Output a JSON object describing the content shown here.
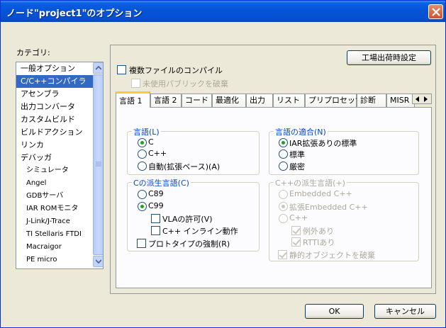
{
  "window": {
    "title": "ノード\"project1\"のオプション",
    "close_label": "close"
  },
  "category": {
    "label": "カテゴリ:",
    "items": [
      "一般オプション",
      "C/C++コンパイラ",
      "アセンブラ",
      "出力コンバータ",
      "カスタムビルド",
      "ビルドアクション",
      "リンカ",
      "デバッガ",
      "シミュレータ",
      "Angel",
      "GDBサーバ",
      "IAR ROMモニタ",
      "J-Link/J-Trace",
      "TI Stellaris FTDI",
      "Macraigor",
      "PE micro"
    ],
    "selected_index": 1
  },
  "panel": {
    "factory_button": "工場出荷時設定",
    "multi_file_compile": "複数ファイルのコンパイル",
    "discard_unused_public": "未使用パブリックを破棄",
    "tabs": [
      "言語 1",
      "言語 2",
      "コード",
      "最適化",
      "出力",
      "リスト",
      "プリプロセッサ",
      "診断",
      "MISR"
    ],
    "active_tab": 0
  },
  "tab1": {
    "language": {
      "title": "言語(L)",
      "options": [
        "C",
        "C++",
        "自動(拡張ベース)(A)"
      ],
      "selected": 0
    },
    "conformance": {
      "title": "言語の適合(N)",
      "options": [
        "IAR拡張ありの標準",
        "標準",
        "厳密"
      ],
      "selected": 0
    },
    "c_dialect": {
      "title": "Cの派生言語(C)",
      "options": [
        "C89",
        "C99"
      ],
      "selected": 1,
      "vla": "VLAの許可(V)",
      "cpp_inline": "C++ インライン動作",
      "require_prototypes": "プロトタイプの強制(R)"
    },
    "cpp_dialect": {
      "title": "C++の派生言語(+)",
      "options": [
        "Embedded C++",
        "拡張Embedded C++",
        "C++"
      ],
      "selected": 1,
      "exceptions": "例外あり",
      "rtti": "RTTIあり",
      "destroy_static": "静的オブジェクトを破棄"
    }
  },
  "buttons": {
    "ok": "OK",
    "cancel": "キャンセル"
  },
  "colors": {
    "titlebar": "#0653d6",
    "selection": "#316ac5",
    "group_title": "#0046d5",
    "tab_accent": "#ffc83c"
  }
}
